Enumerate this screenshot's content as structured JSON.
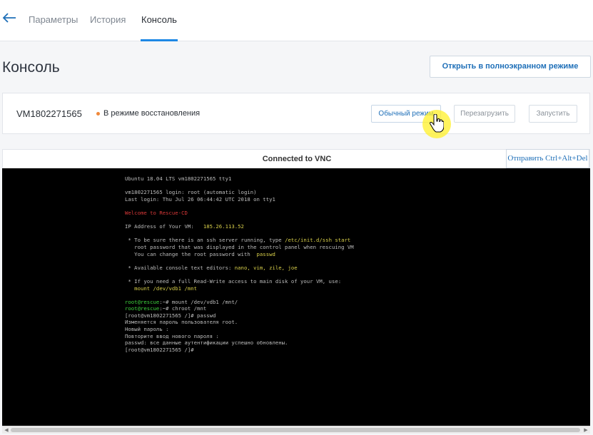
{
  "nav": {
    "tabs": [
      "Параметры",
      "История",
      "Консоль"
    ],
    "active_tab": "Консоль"
  },
  "page": {
    "title": "Консоль",
    "fullscreen_button": "Открыть в полноэкранном режиме"
  },
  "vm": {
    "name": "VM1802271565",
    "status": "В режиме восстановления",
    "status_color": "#f0883a",
    "buttons": {
      "normal_mode": "Обычный режим",
      "reboot": "Перезагрузить",
      "start": "Запустить"
    }
  },
  "vnc": {
    "status": "Connected to VNC",
    "cad_button": "Отправить Ctrl+Alt+Del"
  },
  "terminal": {
    "l01": "Ubuntu 18.04 LTS vm1802271565 tty1",
    "l02": "vm1802271565 login: root (automatic login)",
    "l03": "Last login: Thu Jul 26 06:44:42 UTC 2018 on tty1",
    "l04": "Welcome to Rescue-CD",
    "l05_label": "IP Address of Your VM:",
    "l05_ip": "185.26.113.52",
    "l06_a": " * To be sure there is an ssh server running, type ",
    "l06_cmd": "/etc/init.d/ssh start",
    "l07": "   root password that was displayed in the control panel when rescuing VM",
    "l08_a": "   You can change the root password with  ",
    "l08_cmd": "passwd",
    "l09_a": " * Available console text editors: ",
    "l09_cmd": "nano, vim, zile, joe",
    "l10": " * If you need a full Read-Write access to main disk of your VM, use:",
    "l11": "   mount /dev/vdb1 /mnt",
    "l12_prompt": "root@rescue",
    "l12_rest": ":~# mount /dev/vdb1 /mnt/",
    "l13_prompt": "root@rescue",
    "l13_rest": ":~# chroot /mnt",
    "l14": "[root@vm1802271565 /]# passwd",
    "l15": "Изменяется пароль пользователя root.",
    "l16": "Новый пароль :",
    "l17": "Повторите ввод нового пароля :",
    "l18": "passwd: все данные аутентификации успешно обновлены.",
    "l19": "[root@vm1802271565 /]#"
  },
  "colors": {
    "accent": "#1e88e5",
    "link": "#1e6fb8",
    "terminal_bg": "#000000",
    "terminal_red": "#d83838",
    "terminal_yellow": "#d8cf4a",
    "terminal_green": "#3fd43f"
  },
  "icons": {
    "back": "back-arrow-icon",
    "cursor": "hand-pointer-icon"
  }
}
